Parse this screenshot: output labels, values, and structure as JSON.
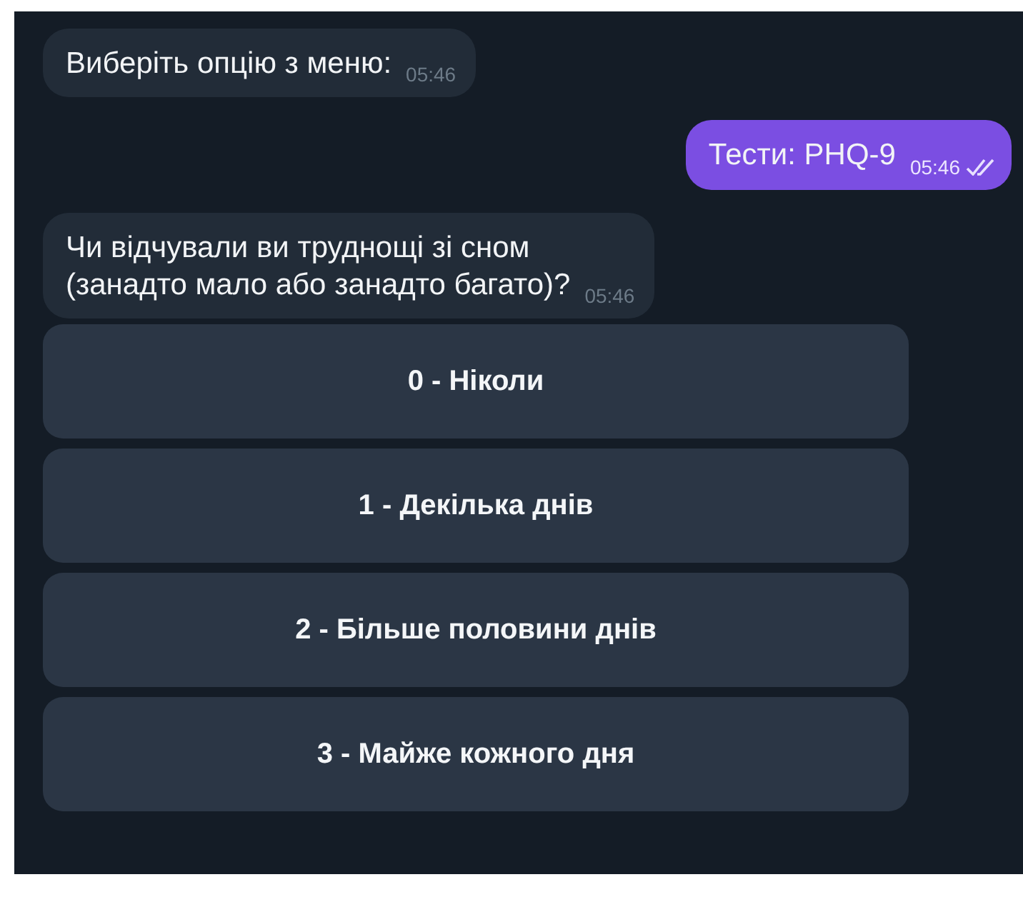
{
  "messages": [
    {
      "kind": "incoming",
      "text": "Виберіть опцію з меню:",
      "time": "05:46"
    },
    {
      "kind": "outgoing",
      "text": "Тести: PHQ-9",
      "time": "05:46",
      "read": true
    },
    {
      "kind": "incoming",
      "text": "Чи відчували ви труднощі зі сном\n(занадто мало або занадто багато)?",
      "time": "05:46"
    }
  ],
  "keyboard": [
    "0 - Ніколи",
    "1 - Декілька днів",
    "2 - Більше половини днів",
    "3 - Майже кожного дня"
  ]
}
